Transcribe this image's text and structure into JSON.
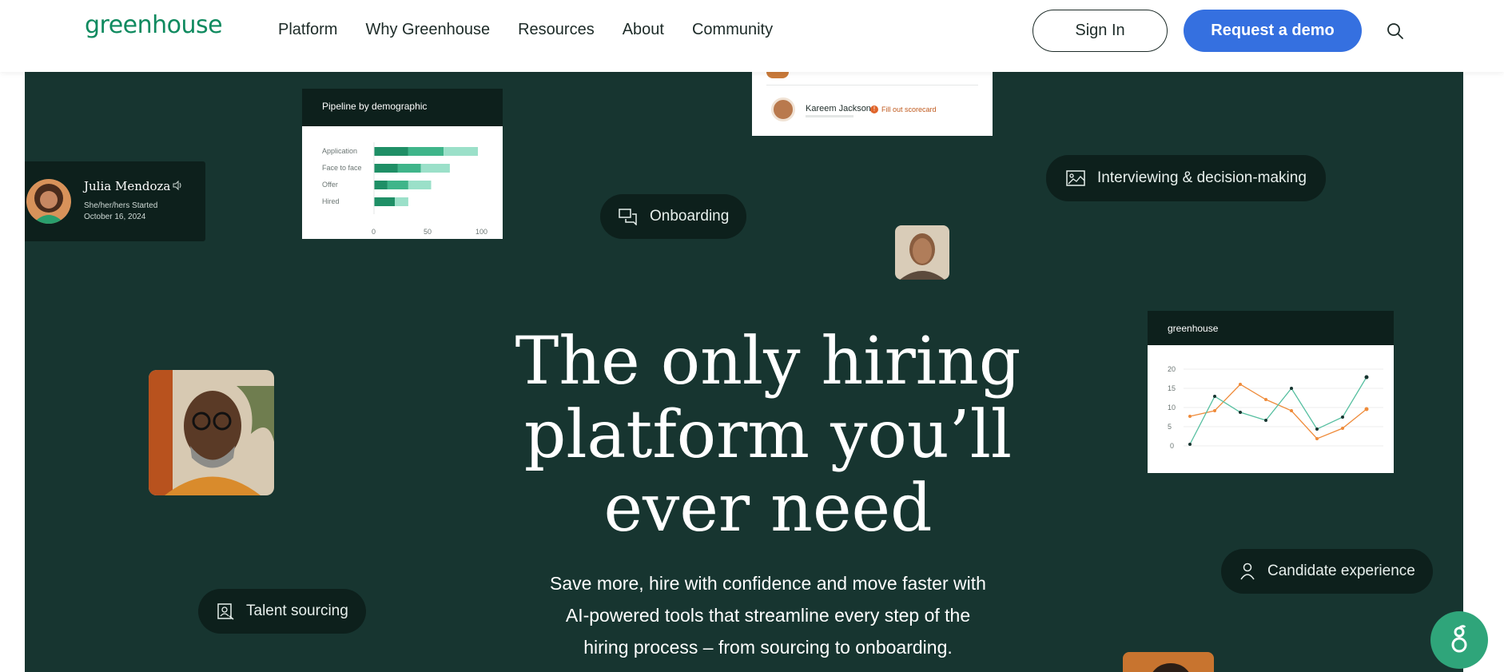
{
  "header": {
    "logo": "greenhouse",
    "nav": [
      "Platform",
      "Why Greenhouse",
      "Resources",
      "About",
      "Community"
    ],
    "sign_in": "Sign In",
    "request_demo": "Request a demo",
    "search_icon": "search-icon"
  },
  "hero": {
    "headline_line1": "The only hiring",
    "headline_line2": "platform you’ll",
    "headline_line3": "ever need",
    "subcopy_line1": "Save more, hire with confidence and move faster with",
    "subcopy_line2": "AI-powered tools that streamline every step of the",
    "subcopy_line3": "hiring process – from sourcing to onboarding.",
    "pills": {
      "onboarding": "Onboarding",
      "interviewing": "Interviewing & decision-making",
      "talent_sourcing": "Talent sourcing",
      "candidate_experience": "Candidate experience"
    },
    "julia_card": {
      "name": "Julia Mendoza",
      "pronouns_status": "She/her/hers  Started",
      "date": "October 16, 2024"
    },
    "pipeline_card": {
      "title": "Pipeline by demographic",
      "rows": [
        "Application",
        "Face to face",
        "Offer",
        "Hired"
      ],
      "ticks": [
        "0",
        "50",
        "100"
      ]
    },
    "kareem_card": {
      "name": "Kareem Jackson",
      "status": "Fill out scorecard"
    },
    "graph_card": {
      "brand": "greenhouse",
      "y_ticks": [
        "20",
        "15",
        "10",
        "5",
        "0"
      ]
    }
  },
  "colors": {
    "brand_green": "#0f8a5f",
    "hero_bg": "#173530",
    "demo_blue": "#3570e0",
    "pill_bg": "#0d201c"
  },
  "chart_data": {
    "type": "bar",
    "title": "Pipeline by demographic",
    "categories": [
      "Application",
      "Face to face",
      "Offer",
      "Hired"
    ],
    "series": [
      {
        "values": [
          33,
          23,
          13,
          20
        ]
      },
      {
        "values": [
          34,
          22,
          20,
          0
        ]
      },
      {
        "values": [
          33,
          28,
          22,
          13
        ]
      }
    ],
    "xlim": [
      0,
      100
    ]
  }
}
